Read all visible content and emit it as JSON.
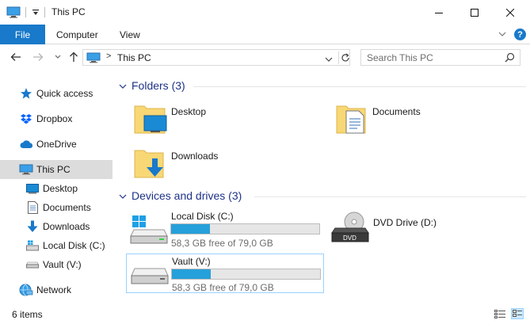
{
  "window": {
    "title": "This PC",
    "controls": {
      "minimize": "—",
      "maximize": "☐",
      "close": "✕"
    }
  },
  "ribbon": {
    "tabs": [
      {
        "label": "File",
        "active": true
      },
      {
        "label": "Computer"
      },
      {
        "label": "View"
      }
    ],
    "help_label": "?"
  },
  "navigation": {
    "back": "←",
    "forward": "→",
    "recent": "⌄",
    "up": "↑",
    "address": {
      "separator": ">",
      "path": "This PC"
    },
    "search": {
      "placeholder": "Search This PC"
    }
  },
  "sidebar": {
    "items": [
      {
        "label": "Quick access",
        "icon": "star-icon"
      },
      {
        "label": "Dropbox",
        "icon": "dropbox-icon"
      },
      {
        "label": "OneDrive",
        "icon": "cloud-icon"
      },
      {
        "label": "This PC",
        "icon": "computer-icon",
        "selected": true
      },
      {
        "label": "Desktop",
        "icon": "desktop-icon"
      },
      {
        "label": "Documents",
        "icon": "documents-icon"
      },
      {
        "label": "Downloads",
        "icon": "download-icon"
      },
      {
        "label": "Local Disk (C:)",
        "icon": "windows-drive-icon"
      },
      {
        "label": "Vault (V:)",
        "icon": "drive-icon"
      },
      {
        "label": "Network",
        "icon": "network-icon"
      }
    ]
  },
  "groups": {
    "folders": {
      "title": "Folders (3)",
      "items": [
        {
          "label": "Desktop",
          "icon": "desktop-folder-icon"
        },
        {
          "label": "Documents",
          "icon": "documents-folder-icon"
        },
        {
          "label": "Downloads",
          "icon": "downloads-folder-icon"
        }
      ]
    },
    "drives": {
      "title": "Devices and drives (3)",
      "items": [
        {
          "label": "Local Disk (C:)",
          "free": "58,3 GB free of 79,0 GB",
          "used_fraction": 0.262,
          "icon": "windows-drive-icon"
        },
        {
          "label": "DVD Drive (D:)",
          "icon": "dvd-drive-icon"
        },
        {
          "label": "Vault (V:)",
          "free": "58,3 GB free of 79,0 GB",
          "used_fraction": 0.262,
          "icon": "hard-drive-icon",
          "selected": true
        }
      ]
    }
  },
  "status": {
    "count": "6 items"
  },
  "colors": {
    "accent": "#1979ca",
    "group_header": "#1e3287",
    "progress": "#26a0da",
    "selection": "#cce8ff"
  }
}
